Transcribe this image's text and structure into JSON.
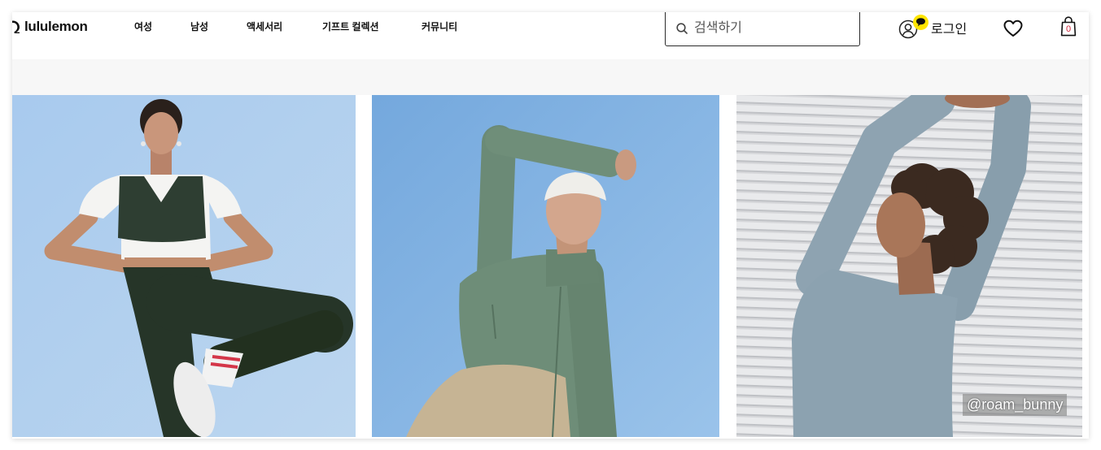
{
  "brand": {
    "name": "lululemon",
    "icon": "lululemon-logo-icon"
  },
  "nav": {
    "items": [
      {
        "label": "여성"
      },
      {
        "label": "남성"
      },
      {
        "label": "액세서리"
      },
      {
        "label": "기프트 컬렉션"
      },
      {
        "label": "커뮤니티"
      }
    ]
  },
  "search": {
    "placeholder": "검색하기",
    "value": "",
    "icon": "search-icon"
  },
  "account": {
    "login_label": "로그인",
    "icon": "user-icon",
    "badge_icon": "chat-bubble-icon"
  },
  "wishlist": {
    "icon": "heart-icon"
  },
  "cart": {
    "icon": "shopping-bag-icon",
    "count": "0"
  },
  "hero": {
    "watermark": "@roam_bunny"
  },
  "colors": {
    "login_badge": "#FFE500",
    "cart_count": "#D0253A",
    "band": "#F7F7F7"
  }
}
